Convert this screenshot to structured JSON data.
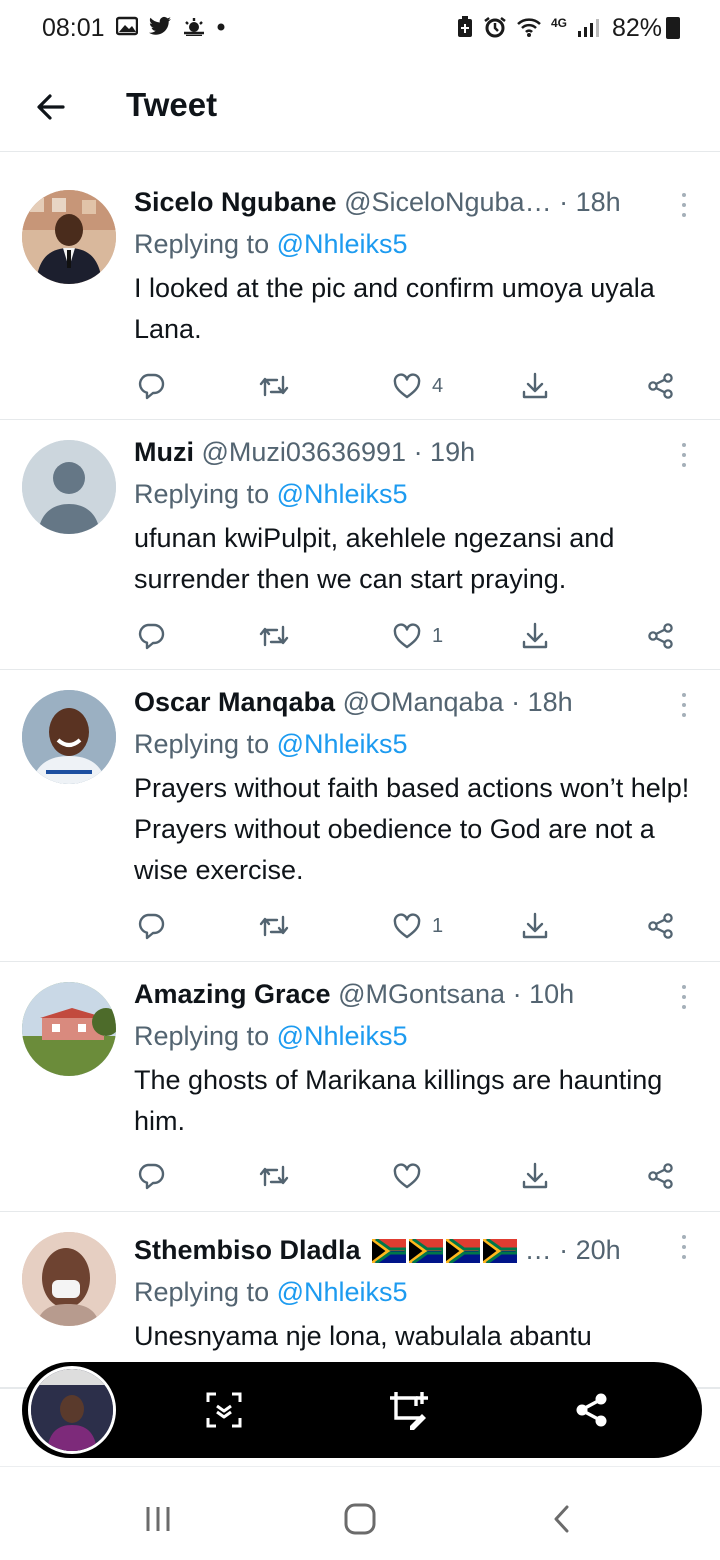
{
  "status_bar": {
    "time": "08:01",
    "network": "4G",
    "battery": "82%"
  },
  "header": {
    "title": "Tweet"
  },
  "tweets": [
    {
      "name": "Sicelo Ngubane",
      "handle": "@SiceloNguba…",
      "time": " · 18h",
      "replying_prefix": "Replying to ",
      "replying_handle": "@Nhleiks5",
      "text": "I looked at the pic and confirm umoya uyala Lana.",
      "likes": "4"
    },
    {
      "name": "Muzi",
      "handle": "@Muzi03636991",
      "time": " · 19h",
      "replying_prefix": "Replying to ",
      "replying_handle": "@Nhleiks5",
      "text": "ufunan kwiPulpit, akehlele ngezansi and surrender then we can start praying.",
      "likes": "1"
    },
    {
      "name": "Oscar Manqaba",
      "handle": "@OManqaba",
      "time": " · 18h",
      "replying_prefix": "Replying to ",
      "replying_handle": "@Nhleiks5",
      "text": "Prayers without faith based actions won’t help! Prayers without obedience to God are not a wise exercise.",
      "likes": "1"
    },
    {
      "name": "Amazing Grace",
      "handle": "@MGontsana",
      "time": " · 10h",
      "replying_prefix": "Replying to ",
      "replying_handle": "@Nhleiks5",
      "text": "The ghosts of Marikana killings are haunting him.",
      "likes": ""
    },
    {
      "name": "Sthembiso Dladla",
      "handle": "…",
      "time": " · 20h",
      "replying_prefix": "Replying to ",
      "replying_handle": "@Nhleiks5",
      "text": "Unesnyama nje lona, wabulala abantu"
    }
  ],
  "colors": {
    "accent": "#1d9bf0",
    "muted": "#536471",
    "text": "#0f1419",
    "divider": "#e6e9eb"
  },
  "icons": {
    "reply": "reply-icon",
    "retweet": "retweet-icon",
    "like": "heart-icon",
    "bookmark": "download-icon",
    "share": "share-icon"
  }
}
